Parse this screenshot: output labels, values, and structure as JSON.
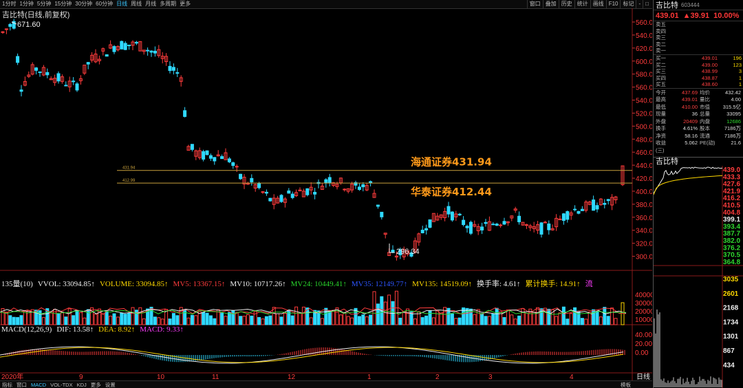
{
  "toolbar": {
    "periods": [
      "1分时",
      "1分钟",
      "5分钟",
      "15分钟",
      "30分钟",
      "60分钟",
      "日线",
      "周线",
      "月线",
      "多周期",
      "更多"
    ],
    "active_period": "日线",
    "tools": [
      "窗口",
      "叠加",
      "历史",
      "统计",
      "画线",
      "F10",
      "标记",
      "-",
      "□"
    ]
  },
  "chart": {
    "title": "吉比特(日线,前复权)",
    "high_label": "671.60",
    "low_label": "296.34",
    "annotation_1": "海通证券431.94",
    "annotation_2": "华泰证券412.44",
    "line1_small_label": "431.94",
    "line2_small_label": "412.99",
    "price_axis": [
      "560.00",
      "540.00",
      "520.00",
      "500.00",
      "580.00",
      "560.00",
      "540.00",
      "520.00",
      "500.00",
      "480.00",
      "460.00",
      "440.00",
      "420.00",
      "400.00",
      "380.00",
      "360.00",
      "340.00",
      "320.00",
      "300.00"
    ],
    "price_axis_shown": [
      "560.0",
      "540.0",
      "620.0",
      "600.0",
      "580.0",
      "560.0",
      "540.0",
      "520.0",
      "500.0",
      "480.0",
      "460.0",
      "440.0",
      "420.0",
      "400.0",
      "380.0",
      "360.0",
      "340.0",
      "320.0",
      "300.0"
    ],
    "months": [
      "2020年",
      "9",
      "10",
      "11",
      "12",
      "1",
      "2",
      "3",
      "4"
    ],
    "right_label": "日线",
    "up_color": "#ff3c3c",
    "down_color": "#2fd9ff"
  },
  "volume_strip": {
    "items": [
      {
        "text": "135量(10)",
        "cls": "wht"
      },
      {
        "text": "VVOL: 33094.85↑",
        "cls": "wht"
      },
      {
        "text": "VOLUME: 33094.85↑",
        "cls": "yel"
      },
      {
        "text": "MV5: 13367.15↑",
        "cls": "red"
      },
      {
        "text": "MV10: 10717.26↑",
        "cls": "wht"
      },
      {
        "text": "MV24: 10449.41↑",
        "cls": "green"
      },
      {
        "text": "MV35: 12149.77↑",
        "cls": "blu"
      },
      {
        "text": "MV135: 14519.09↑",
        "cls": "yel"
      },
      {
        "text": "换手率: 4.61↑",
        "cls": "wht"
      },
      {
        "text": "累计换手: 14.91↑",
        "cls": "yel"
      },
      {
        "text": "流",
        "cls": "mag"
      }
    ],
    "axis": [
      "40000",
      "30000",
      "20000",
      "10000"
    ]
  },
  "macd_strip": {
    "items": [
      {
        "text": "MACD(12,26,9)",
        "cls": "wht"
      },
      {
        "text": "DIF: 13.58↑",
        "cls": "wht"
      },
      {
        "text": "DEA: 8.92↑",
        "cls": "yel"
      },
      {
        "text": "MACD: 9.33↑",
        "cls": "mag"
      }
    ],
    "axis": [
      "40.00",
      "20.00",
      "0.00"
    ]
  },
  "right_panel": {
    "name": "吉比特",
    "code": "603444",
    "price": "439.01",
    "change": "▲39.91",
    "change_pct": "10.00%",
    "sells": [
      {
        "label": "卖五",
        "price": "",
        "vol": ""
      },
      {
        "label": "卖四",
        "price": "",
        "vol": ""
      },
      {
        "label": "卖三",
        "price": "",
        "vol": ""
      },
      {
        "label": "卖二",
        "price": "",
        "vol": ""
      },
      {
        "label": "卖一",
        "price": "",
        "vol": ""
      }
    ],
    "buys": [
      {
        "label": "买一",
        "price": "439.01",
        "vol": "196"
      },
      {
        "label": "买二",
        "price": "439.00",
        "vol": "123"
      },
      {
        "label": "买三",
        "price": "438.99",
        "vol": "3"
      },
      {
        "label": "买四",
        "price": "438.87",
        "vol": "1"
      },
      {
        "label": "买五",
        "price": "438.60",
        "vol": "1"
      }
    ],
    "stats": [
      {
        "a": "今开",
        "b": "437.69",
        "c": "均价",
        "d": "432.42"
      },
      {
        "a": "最高",
        "b": "439.01",
        "c": "量比",
        "d": "4.00"
      },
      {
        "a": "最低",
        "b": "410.00",
        "c": "市值",
        "d": "315.5亿"
      },
      {
        "a": "现量",
        "b": "36",
        "c": "总量",
        "d": "33095"
      },
      {
        "a": "外盘",
        "b": "20409",
        "c": "内盘",
        "d": "12686"
      },
      {
        "a": "换手",
        "b": "4.61%",
        "c": "股本",
        "d": "7186万"
      },
      {
        "a": "净资",
        "b": "58.16",
        "c": "流通",
        "d": "7186万"
      },
      {
        "a": "收益(三)",
        "b": "5.062",
        "c": "PE(动)",
        "d": "21.6"
      }
    ],
    "mini_title": "吉比特",
    "mini_axis": [
      "439.0",
      "433.3",
      "427.6",
      "421.9",
      "416.2",
      "410.5",
      "404.8",
      "399.1",
      "393.4",
      "387.7",
      "382.0",
      "376.2",
      "370.5",
      "364.8",
      "3035",
      "2601",
      "2168",
      "1734",
      "1301",
      "867",
      "434"
    ]
  },
  "bottom_tabs": [
    "指标",
    "窗口",
    "MACD",
    "VOL-TDX",
    "KDJ",
    "更多",
    "设置"
  ],
  "bottom_active": "MACD",
  "bottom_right": "模板"
}
